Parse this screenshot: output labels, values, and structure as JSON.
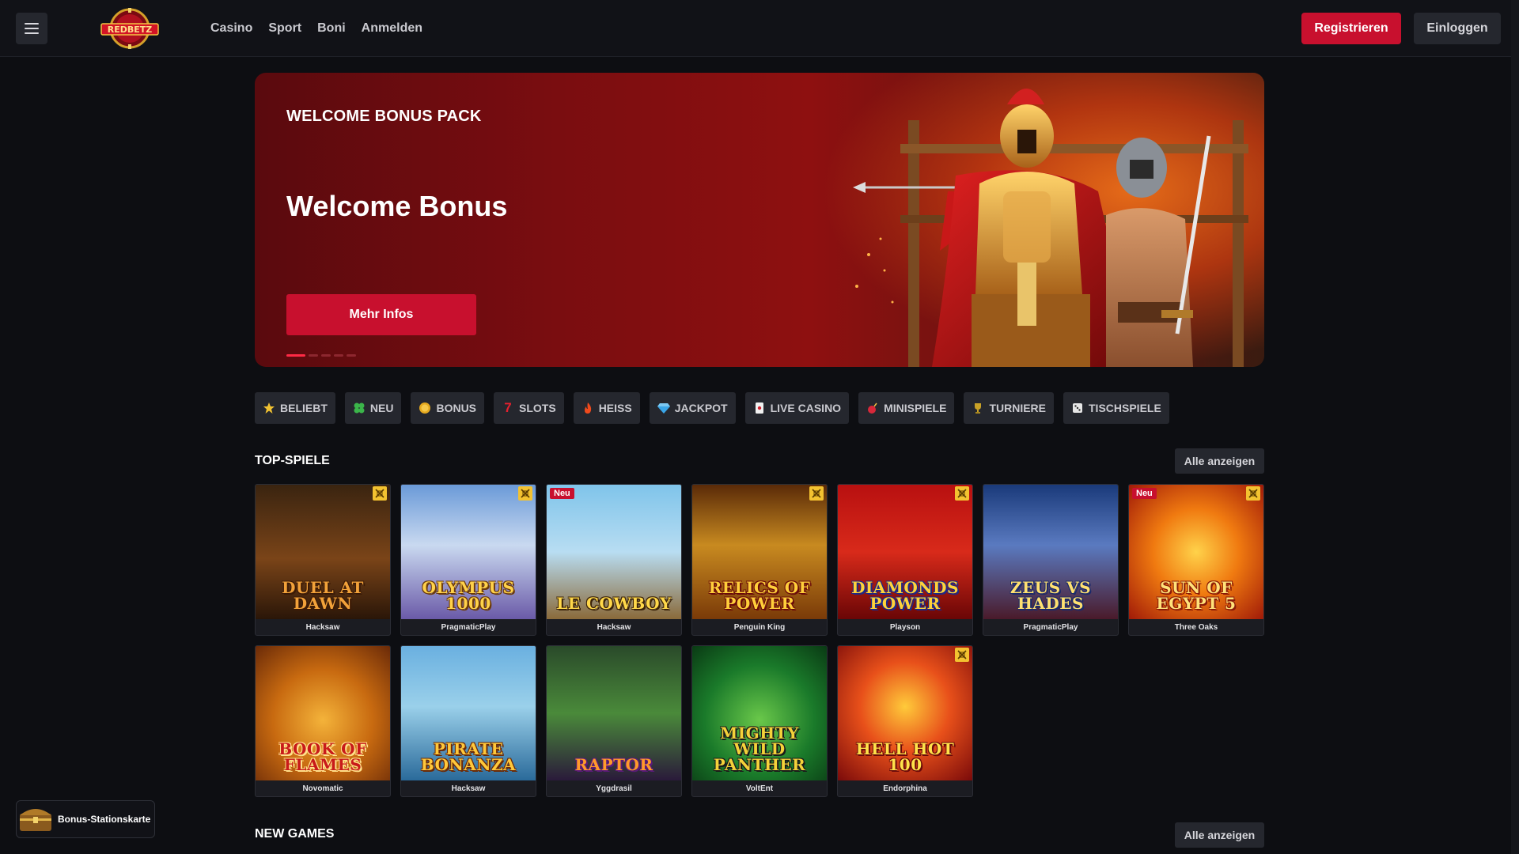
{
  "header": {
    "logo_text": "REDBETZ",
    "nav": [
      "Casino",
      "Sport",
      "Boni",
      "Anmelden"
    ],
    "register_label": "Registrieren",
    "login_label": "Einloggen"
  },
  "hero": {
    "eyebrow": "WELCOME BONUS PACK",
    "title": "Welcome Bonus",
    "cta_label": "Mehr Infos",
    "slide_count": 5,
    "active_slide": 1
  },
  "categories": [
    {
      "label": "BELIEBT",
      "icon": "star-icon"
    },
    {
      "label": "NEU",
      "icon": "clover-icon"
    },
    {
      "label": "BONUS",
      "icon": "coin-icon"
    },
    {
      "label": "SLOTS",
      "icon": "seven-icon"
    },
    {
      "label": "HEISS",
      "icon": "flame-icon"
    },
    {
      "label": "JACKPOT",
      "icon": "diamond-icon"
    },
    {
      "label": "LIVE CASINO",
      "icon": "card-icon"
    },
    {
      "label": "MINISPIELE",
      "icon": "bomb-icon"
    },
    {
      "label": "TURNIERE",
      "icon": "trophy-icon"
    },
    {
      "label": "TISCHSPIELE",
      "icon": "dice-icon"
    }
  ],
  "top_games": {
    "title": "TOP-SPIELE",
    "all_label": "Alle anzeigen",
    "badge_new": "Neu",
    "games": [
      {
        "art": "DUEL AT DAWN",
        "provider": "Hacksaw",
        "new": false,
        "flag": true
      },
      {
        "art": "OLYMPUS 1000",
        "provider": "PragmaticPlay",
        "new": false,
        "flag": true
      },
      {
        "art": "LE COWBOY",
        "provider": "Hacksaw",
        "new": true,
        "flag": false
      },
      {
        "art": "RELICS OF POWER",
        "provider": "Penguin King",
        "new": false,
        "flag": true
      },
      {
        "art": "DIAMONDS POWER",
        "provider": "Playson",
        "new": false,
        "flag": true
      },
      {
        "art": "ZEUS VS HADES",
        "provider": "PragmaticPlay",
        "new": false,
        "flag": false
      },
      {
        "art": "SUN OF EGYPT 5",
        "provider": "Three Oaks",
        "new": true,
        "flag": true
      },
      {
        "art": "BOOK OF FLAMES",
        "provider": "Novomatic",
        "new": false,
        "flag": false
      },
      {
        "art": "PIRATE BONANZA",
        "provider": "Hacksaw",
        "new": false,
        "flag": false
      },
      {
        "art": "RAPTOR",
        "provider": "Yggdrasil",
        "new": false,
        "flag": false
      },
      {
        "art": "MIGHTY WILD PANTHER",
        "provider": "VoltEnt",
        "new": false,
        "flag": false
      },
      {
        "art": "HELL HOT 100",
        "provider": "Endorphina",
        "new": false,
        "flag": true
      }
    ]
  },
  "new_games": {
    "title": "NEW GAMES",
    "all_label": "Alle anzeigen"
  },
  "bonus_station": {
    "label": "Bonus-Stationskarte"
  },
  "colors": {
    "accent": "#c8102e",
    "background": "#0d0e12",
    "chip": "#25272e",
    "flag": "#f3c230"
  }
}
